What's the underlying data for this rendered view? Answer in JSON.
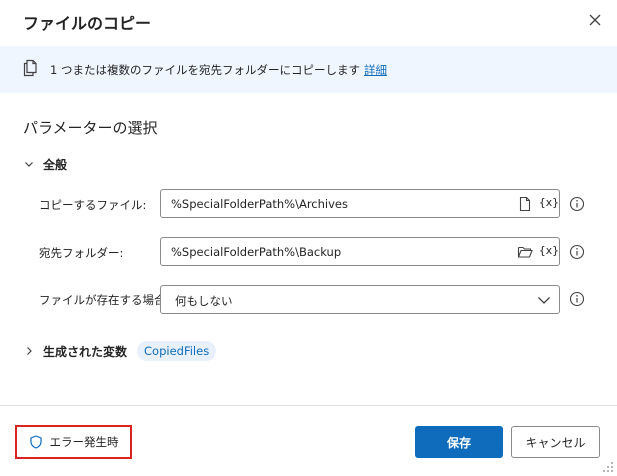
{
  "dialog": {
    "title": "ファイルのコピー",
    "close_icon": "close-icon"
  },
  "info": {
    "icon": "copy-icon",
    "text": "1 つまたは複数のファイルを宛先フォルダーにコピーします",
    "link": "詳細"
  },
  "parameters": {
    "title": "パラメーターの選択",
    "general": {
      "label": "全般",
      "expanded": true
    },
    "files_to_copy": {
      "label": "コピーするファイル:",
      "value": "%SpecialFolderPath%\\Archives",
      "icon": "file-icon",
      "var_label": "{x}"
    },
    "destination_folder": {
      "label": "宛先フォルダー:",
      "value": "%SpecialFolderPath%\\Backup",
      "icon": "folder-icon",
      "var_label": "{x}"
    },
    "if_exists": {
      "label": "ファイルが存在する場合:",
      "selected": "何もしない"
    }
  },
  "generated_vars": {
    "label": "生成された変数",
    "expanded": false,
    "chip": "CopiedFiles"
  },
  "footer": {
    "error_label": "エラー発生時",
    "save_label": "保存",
    "cancel_label": "キャンセル"
  },
  "colors": {
    "accent": "#0f6cbd",
    "banner_bg": "#f0f6ff",
    "chip_bg": "#e8f1fb",
    "error_border": "#d92323"
  }
}
